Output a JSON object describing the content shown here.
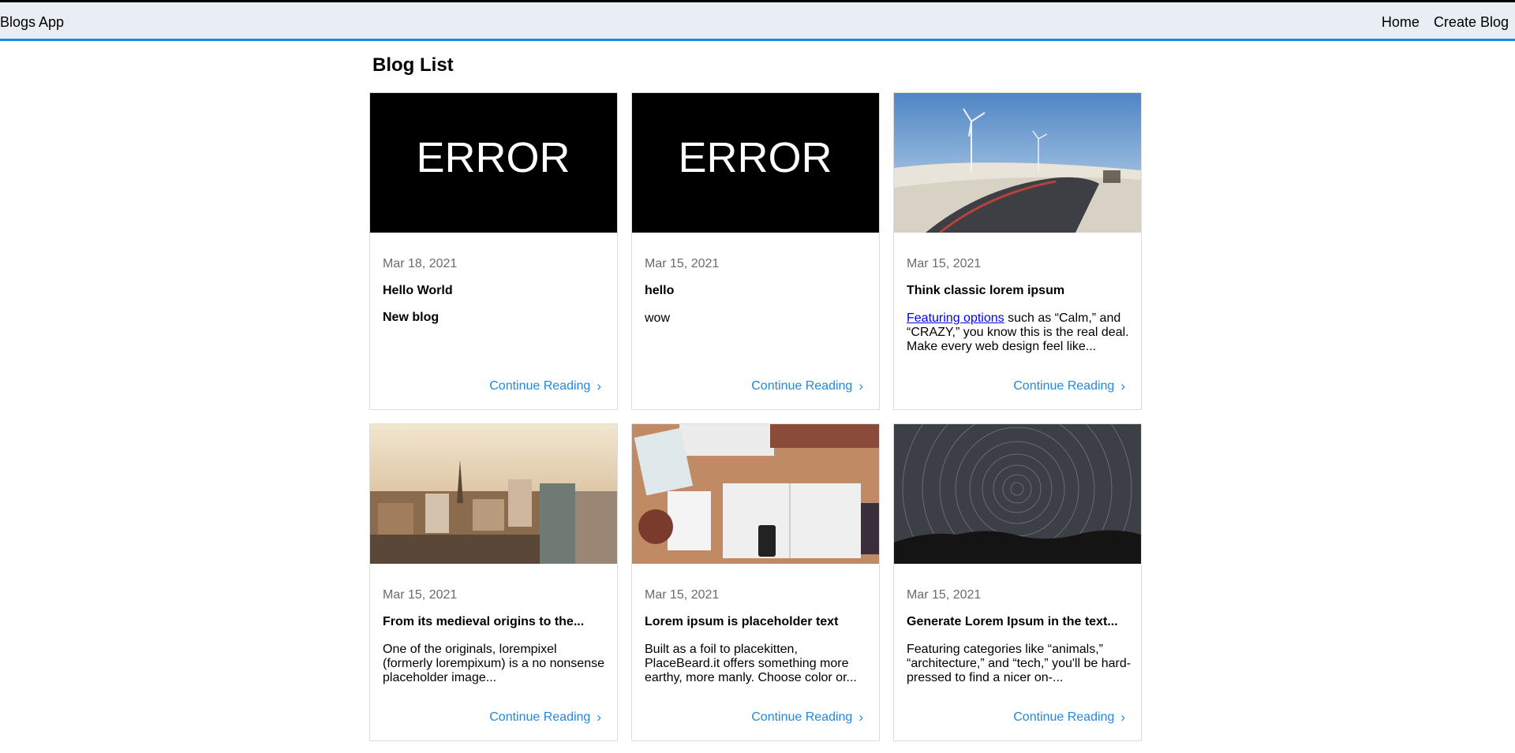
{
  "app": {
    "brand": "Blogs App"
  },
  "nav": {
    "home": "Home",
    "create": "Create Blog"
  },
  "page": {
    "title": "Blog List"
  },
  "cta_label": "Continue Reading",
  "posts": [
    {
      "image": "error-image",
      "image_text": "ERROR",
      "date": "Mar 18, 2021",
      "title": "Hello World",
      "excerpt": "New blog",
      "excerpt_bold": true
    },
    {
      "image": "error-image",
      "image_text": "ERROR",
      "date": "Mar 15, 2021",
      "title": "hello",
      "excerpt": "wow"
    },
    {
      "image": "wind-turbines-road-photo",
      "date": "Mar 15, 2021",
      "title": "Think classic lorem ipsum",
      "excerpt_link": "Featuring options",
      "excerpt": " such as “Calm,” and “CRAZY,” you know this is the real deal. Make every web design feel like..."
    },
    {
      "image": "city-rooftops-photo",
      "date": "Mar 15, 2021",
      "title": "From its medieval origins to the...",
      "excerpt": "One of the originals, lorempixel (formerly lorempixum) is a no nonsense placeholder image..."
    },
    {
      "image": "desk-workspace-photo",
      "date": "Mar 15, 2021",
      "title": "Lorem ipsum is placeholder text",
      "excerpt": "Built as a foil to placekitten, PlaceBeard.it offers something more earthy, more manly. Choose color or..."
    },
    {
      "image": "star-trails-photo",
      "date": "Mar 15, 2021",
      "title": "Generate Lorem Ipsum in the text...",
      "excerpt": "Featuring categories like “animals,” “architecture,” and “tech,” you'll be hard-pressed to find a nicer on-..."
    }
  ]
}
